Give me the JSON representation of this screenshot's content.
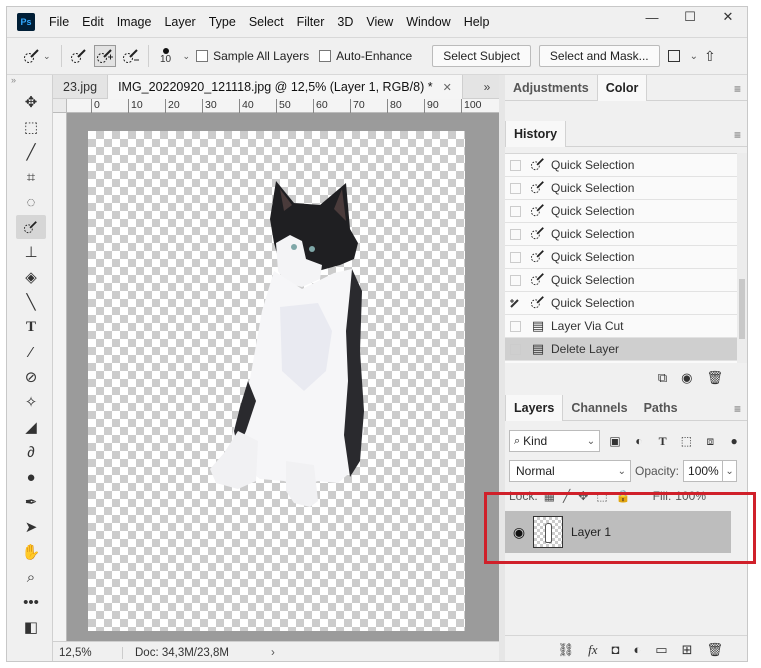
{
  "app": {
    "logo_text": "Ps",
    "menu": [
      "File",
      "Edit",
      "Image",
      "Layer",
      "Type",
      "Select",
      "Filter",
      "3D",
      "View",
      "Window",
      "Help"
    ],
    "window_controls": [
      "—",
      "☐",
      "✕"
    ]
  },
  "options_bar": {
    "brush_size": "10",
    "sample_all_layers": "Sample All Layers",
    "auto_enhance": "Auto-Enhance",
    "select_subject": "Select Subject",
    "select_and_mask": "Select and Mask..."
  },
  "tabs": {
    "items": [
      {
        "label": "23.jpg",
        "active": false
      },
      {
        "label": "IMG_20220920_121118.jpg @ 12,5% (Layer 1, RGB/8) *",
        "active": true
      }
    ],
    "more": "»"
  },
  "ruler": {
    "h_ticks": [
      "0",
      "10",
      "20",
      "30",
      "40",
      "50",
      "60",
      "70",
      "80",
      "90",
      "100"
    ]
  },
  "status": {
    "zoom": "12,5%",
    "doc": "Doc: 34,3M/23,8M",
    "arrow": "›"
  },
  "panels": {
    "top_tabs": [
      "Adjustments",
      "Color"
    ],
    "history_tab": "History",
    "history": [
      {
        "label": "Quick Selection",
        "icon": "quick-selection-icon",
        "source": false,
        "selected": false
      },
      {
        "label": "Quick Selection",
        "icon": "quick-selection-icon",
        "source": false,
        "selected": false
      },
      {
        "label": "Quick Selection",
        "icon": "quick-selection-icon",
        "source": false,
        "selected": false
      },
      {
        "label": "Quick Selection",
        "icon": "quick-selection-icon",
        "source": false,
        "selected": false
      },
      {
        "label": "Quick Selection",
        "icon": "quick-selection-icon",
        "source": false,
        "selected": false
      },
      {
        "label": "Quick Selection",
        "icon": "quick-selection-icon",
        "source": false,
        "selected": false
      },
      {
        "label": "Quick Selection",
        "icon": "quick-selection-icon",
        "source": true,
        "selected": false
      },
      {
        "label": "Layer Via Cut",
        "icon": "document-icon",
        "source": false,
        "selected": false
      },
      {
        "label": "Delete Layer",
        "icon": "document-icon",
        "source": false,
        "selected": true
      }
    ],
    "layers_tabs": [
      "Layers",
      "Channels",
      "Paths"
    ],
    "kind_filter": "Kind",
    "blend_mode": "Normal",
    "opacity_label": "Opacity:",
    "opacity_value": "100%",
    "lock_label": "Lock:",
    "fill_label": "Fill:",
    "fill_value": "100%",
    "layer_name": "Layer 1"
  },
  "colors": {
    "highlight": "#d0202a",
    "selected_row": "#bdbdbd"
  }
}
